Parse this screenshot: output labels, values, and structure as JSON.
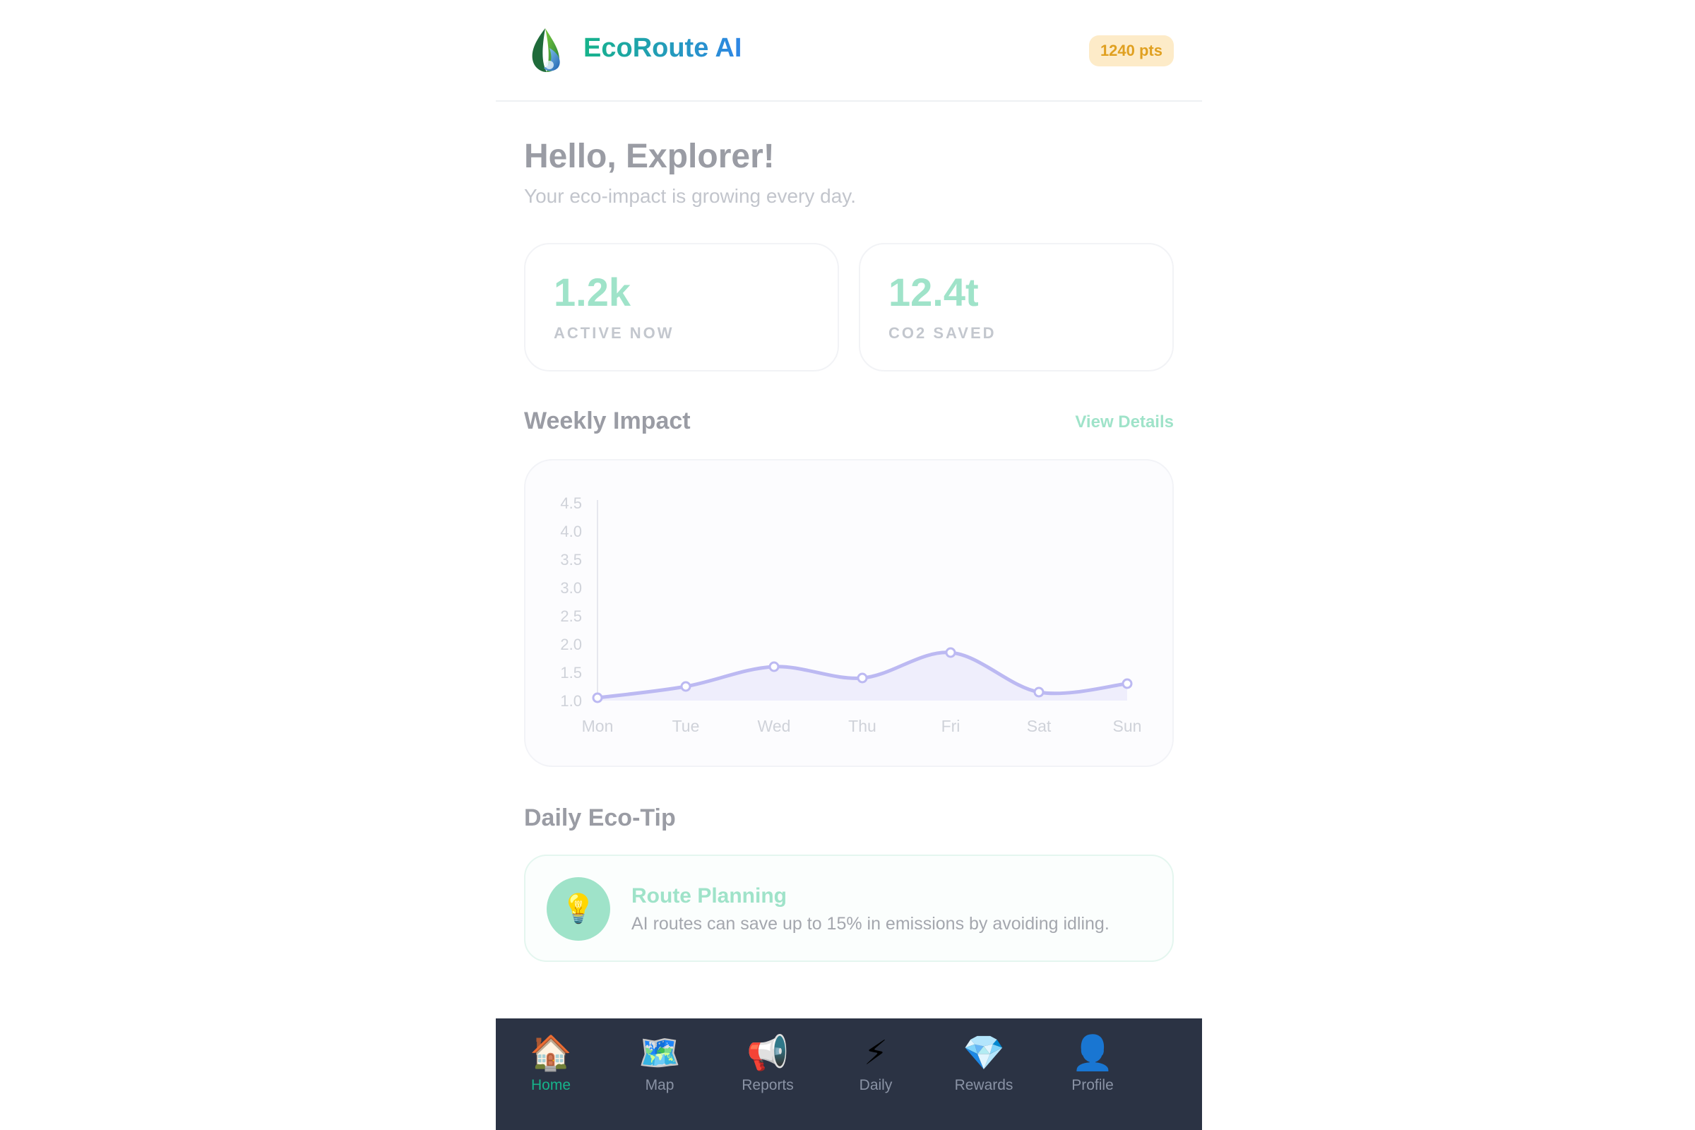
{
  "header": {
    "brand": "EcoRoute AI",
    "points": "1240 pts",
    "colors": {
      "brand_start": "#16b38a",
      "brand_end": "#2f86e6",
      "points_bg": "#fdebc8",
      "points_fg": "#e0a020"
    }
  },
  "greeting": {
    "title": "Hello, Explorer!",
    "subtitle": "Your eco-impact is growing every day."
  },
  "stats": [
    {
      "value": "1.2k",
      "label": "ACTIVE NOW"
    },
    {
      "value": "12.4t",
      "label": "CO2 SAVED"
    }
  ],
  "weekly": {
    "title": "Weekly Impact",
    "link": "View Details"
  },
  "chart_data": {
    "type": "area",
    "categories": [
      "Mon",
      "Tue",
      "Wed",
      "Thu",
      "Fri",
      "Sat",
      "Sun"
    ],
    "values": [
      1.05,
      1.25,
      1.6,
      1.4,
      1.85,
      1.15,
      1.3
    ],
    "yticks": [
      "1.0",
      "1.5",
      "2.0",
      "2.5",
      "3.0",
      "3.5",
      "4.0",
      "4.5"
    ],
    "ylim": [
      1.0,
      4.5
    ],
    "grid": false,
    "line_color": "#bcb9f2",
    "fill_color": "#efeefc"
  },
  "tip": {
    "section_title": "Daily Eco-Tip",
    "icon": "lightbulb-icon",
    "title": "Route Planning",
    "text": "AI routes can save up to 15% in emissions by avoiding idling."
  },
  "nav": {
    "items": [
      {
        "icon": "🏠",
        "icon_name": "home-icon",
        "label": "Home",
        "active": true
      },
      {
        "icon": "🗺️",
        "icon_name": "map-icon",
        "label": "Map",
        "active": false
      },
      {
        "icon": "📢",
        "icon_name": "megaphone-icon",
        "label": "Reports",
        "active": false
      },
      {
        "icon": "⚡",
        "icon_name": "lightning-icon",
        "label": "Daily",
        "active": false
      },
      {
        "icon": "💎",
        "icon_name": "gem-icon",
        "label": "Rewards",
        "active": false
      },
      {
        "icon": "👤",
        "icon_name": "person-icon",
        "label": "Profile",
        "active": false
      }
    ],
    "active_color": "#16b38a"
  }
}
